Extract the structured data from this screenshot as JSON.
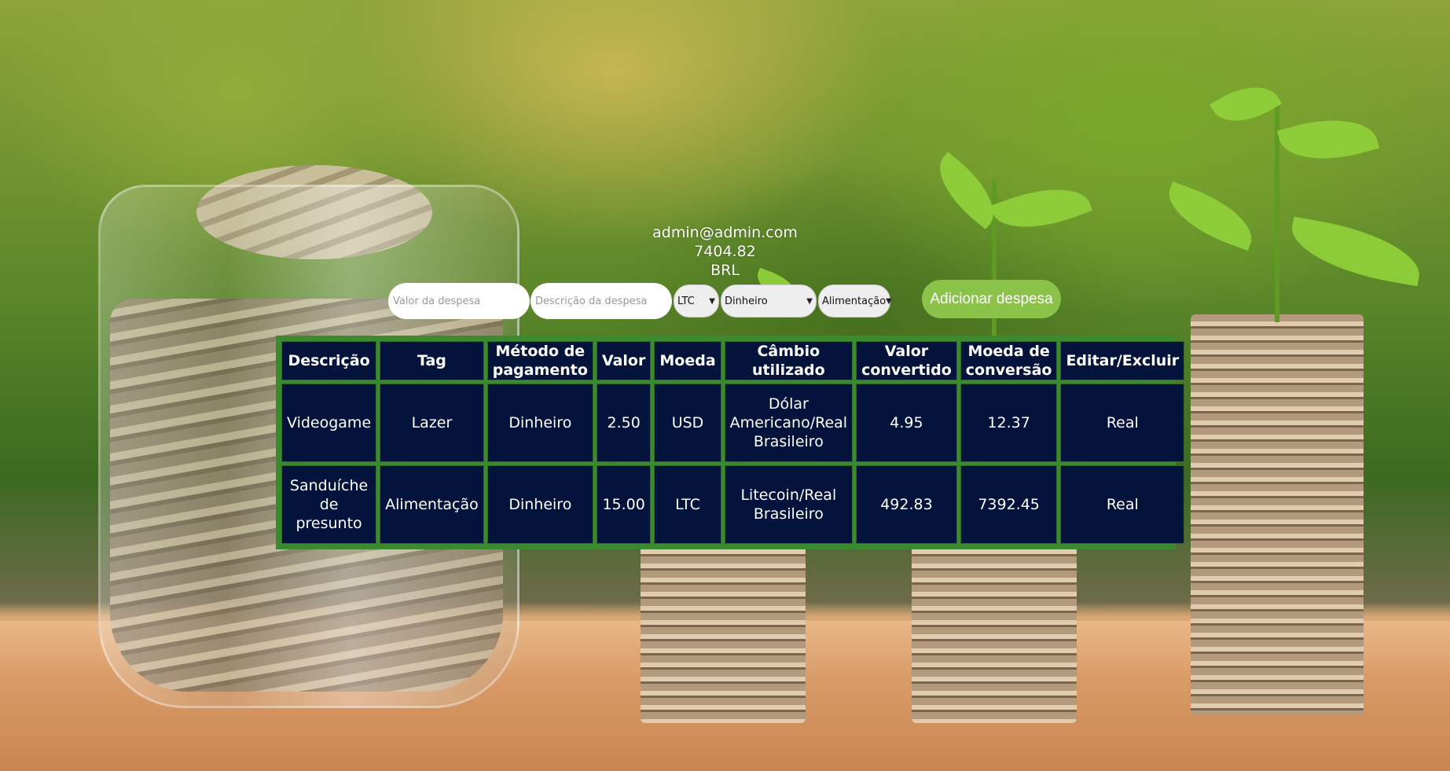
{
  "header": {
    "email": "admin@admin.com",
    "total": "7404.82",
    "currency": "BRL"
  },
  "form": {
    "value_placeholder": "Valor da despesa",
    "description_placeholder": "Descrição da despesa",
    "currency_selected": "LTC",
    "method_selected": "Dinheiro",
    "tag_selected": "Alimentação",
    "add_button_label": "Adicionar despesa"
  },
  "table": {
    "headers": [
      "Descrição",
      "Tag",
      "Método de pagamento",
      "Valor",
      "Moeda",
      "Câmbio utilizado",
      "Valor convertido",
      "Moeda de conversão",
      "Editar/Excluir"
    ],
    "rows": [
      [
        "Videogame",
        "Lazer",
        "Dinheiro",
        "2.50",
        "USD",
        "Dólar Americano/Real Brasileiro",
        "4.95",
        "12.37",
        "Real"
      ],
      [
        "Sanduíche de presunto",
        "Alimentação",
        "Dinheiro",
        "15.00",
        "LTC",
        "Litecoin/Real Brasileiro",
        "492.83",
        "7392.45",
        "Real"
      ]
    ]
  },
  "colors": {
    "accent_button": "#8bc34a",
    "table_cell": "#03133b",
    "table_border": "#3b8a2f"
  }
}
